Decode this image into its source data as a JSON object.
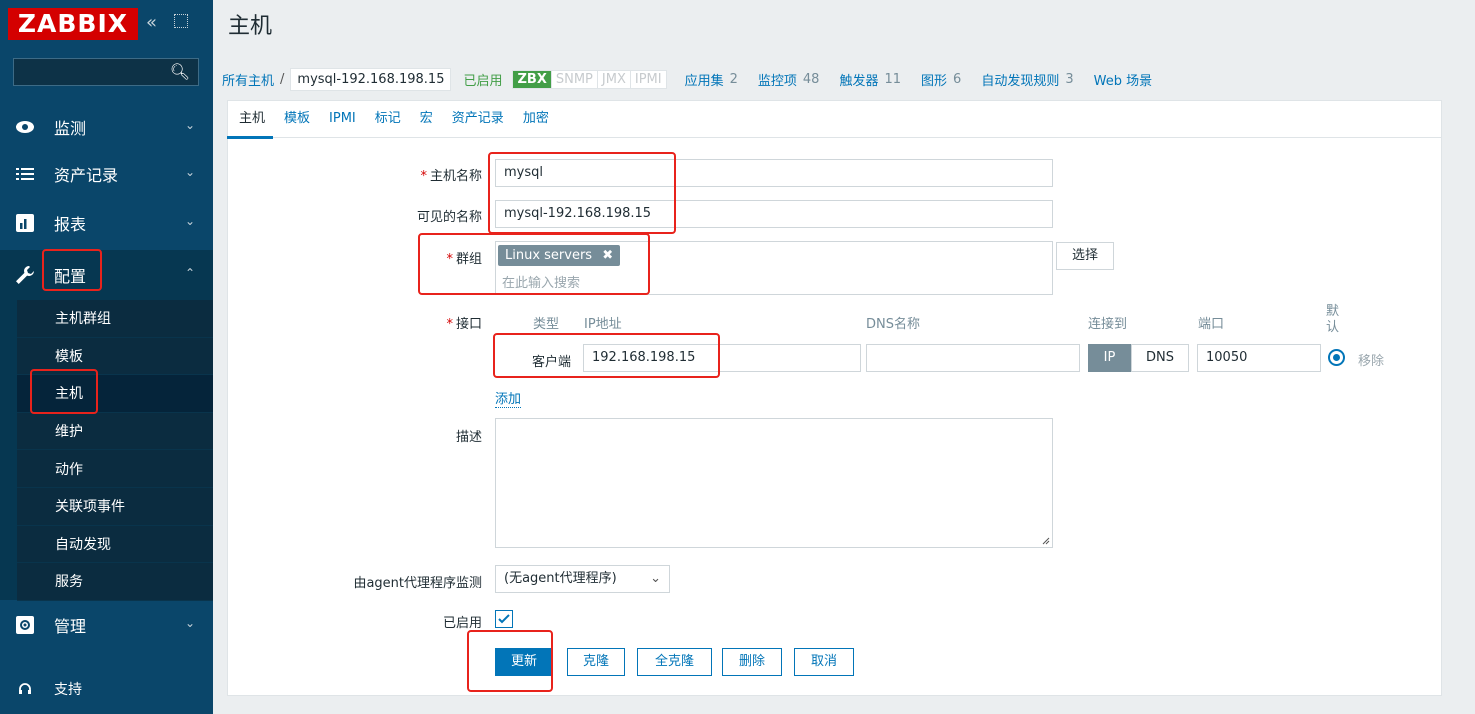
{
  "sidebar": {
    "logo": "ZABBIX",
    "collapse_glyph": "«",
    "nav": [
      {
        "label": "监测",
        "icon": "eye-icon"
      },
      {
        "label": "资产记录",
        "icon": "list-icon"
      },
      {
        "label": "报表",
        "icon": "bar-chart-icon"
      },
      {
        "label": "配置",
        "icon": "wrench-icon"
      },
      {
        "label": "管理",
        "icon": "gear-icon"
      }
    ],
    "config_sub": [
      "主机群组",
      "模板",
      "主机",
      "维护",
      "动作",
      "关联项事件",
      "自动发现",
      "服务"
    ],
    "support": "支持"
  },
  "page": {
    "title": "主机"
  },
  "breadcrumb": {
    "all_hosts": "所有主机",
    "separator": "/",
    "current": "mysql-192.168.198.15",
    "status": "已启用",
    "availability": [
      "ZBX",
      "SNMP",
      "JMX",
      "IPMI"
    ],
    "stats": [
      {
        "label": "应用集",
        "count": "2"
      },
      {
        "label": "监控项",
        "count": "48"
      },
      {
        "label": "触发器",
        "count": "11"
      },
      {
        "label": "图形",
        "count": "6"
      },
      {
        "label": "自动发现规则",
        "count": "3"
      },
      {
        "label": "Web 场景",
        "count": ""
      }
    ]
  },
  "tabs": [
    "主机",
    "模板",
    "IPMI",
    "标记",
    "宏",
    "资产记录",
    "加密"
  ],
  "form": {
    "host_name_label": "主机名称",
    "host_name_value": "mysql",
    "visible_name_label": "可见的名称",
    "visible_name_value": "mysql-192.168.198.15",
    "groups_label": "群组",
    "group_tag": "Linux servers",
    "group_placeholder": "在此输入搜索",
    "select_button": "选择",
    "interfaces_label": "接口",
    "iface_headers": {
      "type": "类型",
      "ip": "IP地址",
      "dns": "DNS名称",
      "connect": "连接到",
      "port": "端口",
      "default": "默认"
    },
    "iface_type": "客户端",
    "iface_ip": "192.168.198.15",
    "iface_dns": "",
    "connect_ip": "IP",
    "connect_dns": "DNS",
    "iface_port": "10050",
    "remove_link": "移除",
    "add_link": "添加",
    "description_label": "描述",
    "proxy_label": "由agent代理程序监测",
    "proxy_value": "(无agent代理程序)",
    "enabled_label": "已启用",
    "buttons": {
      "update": "更新",
      "clone": "克隆",
      "full_clone": "全克隆",
      "delete": "删除",
      "cancel": "取消"
    }
  }
}
